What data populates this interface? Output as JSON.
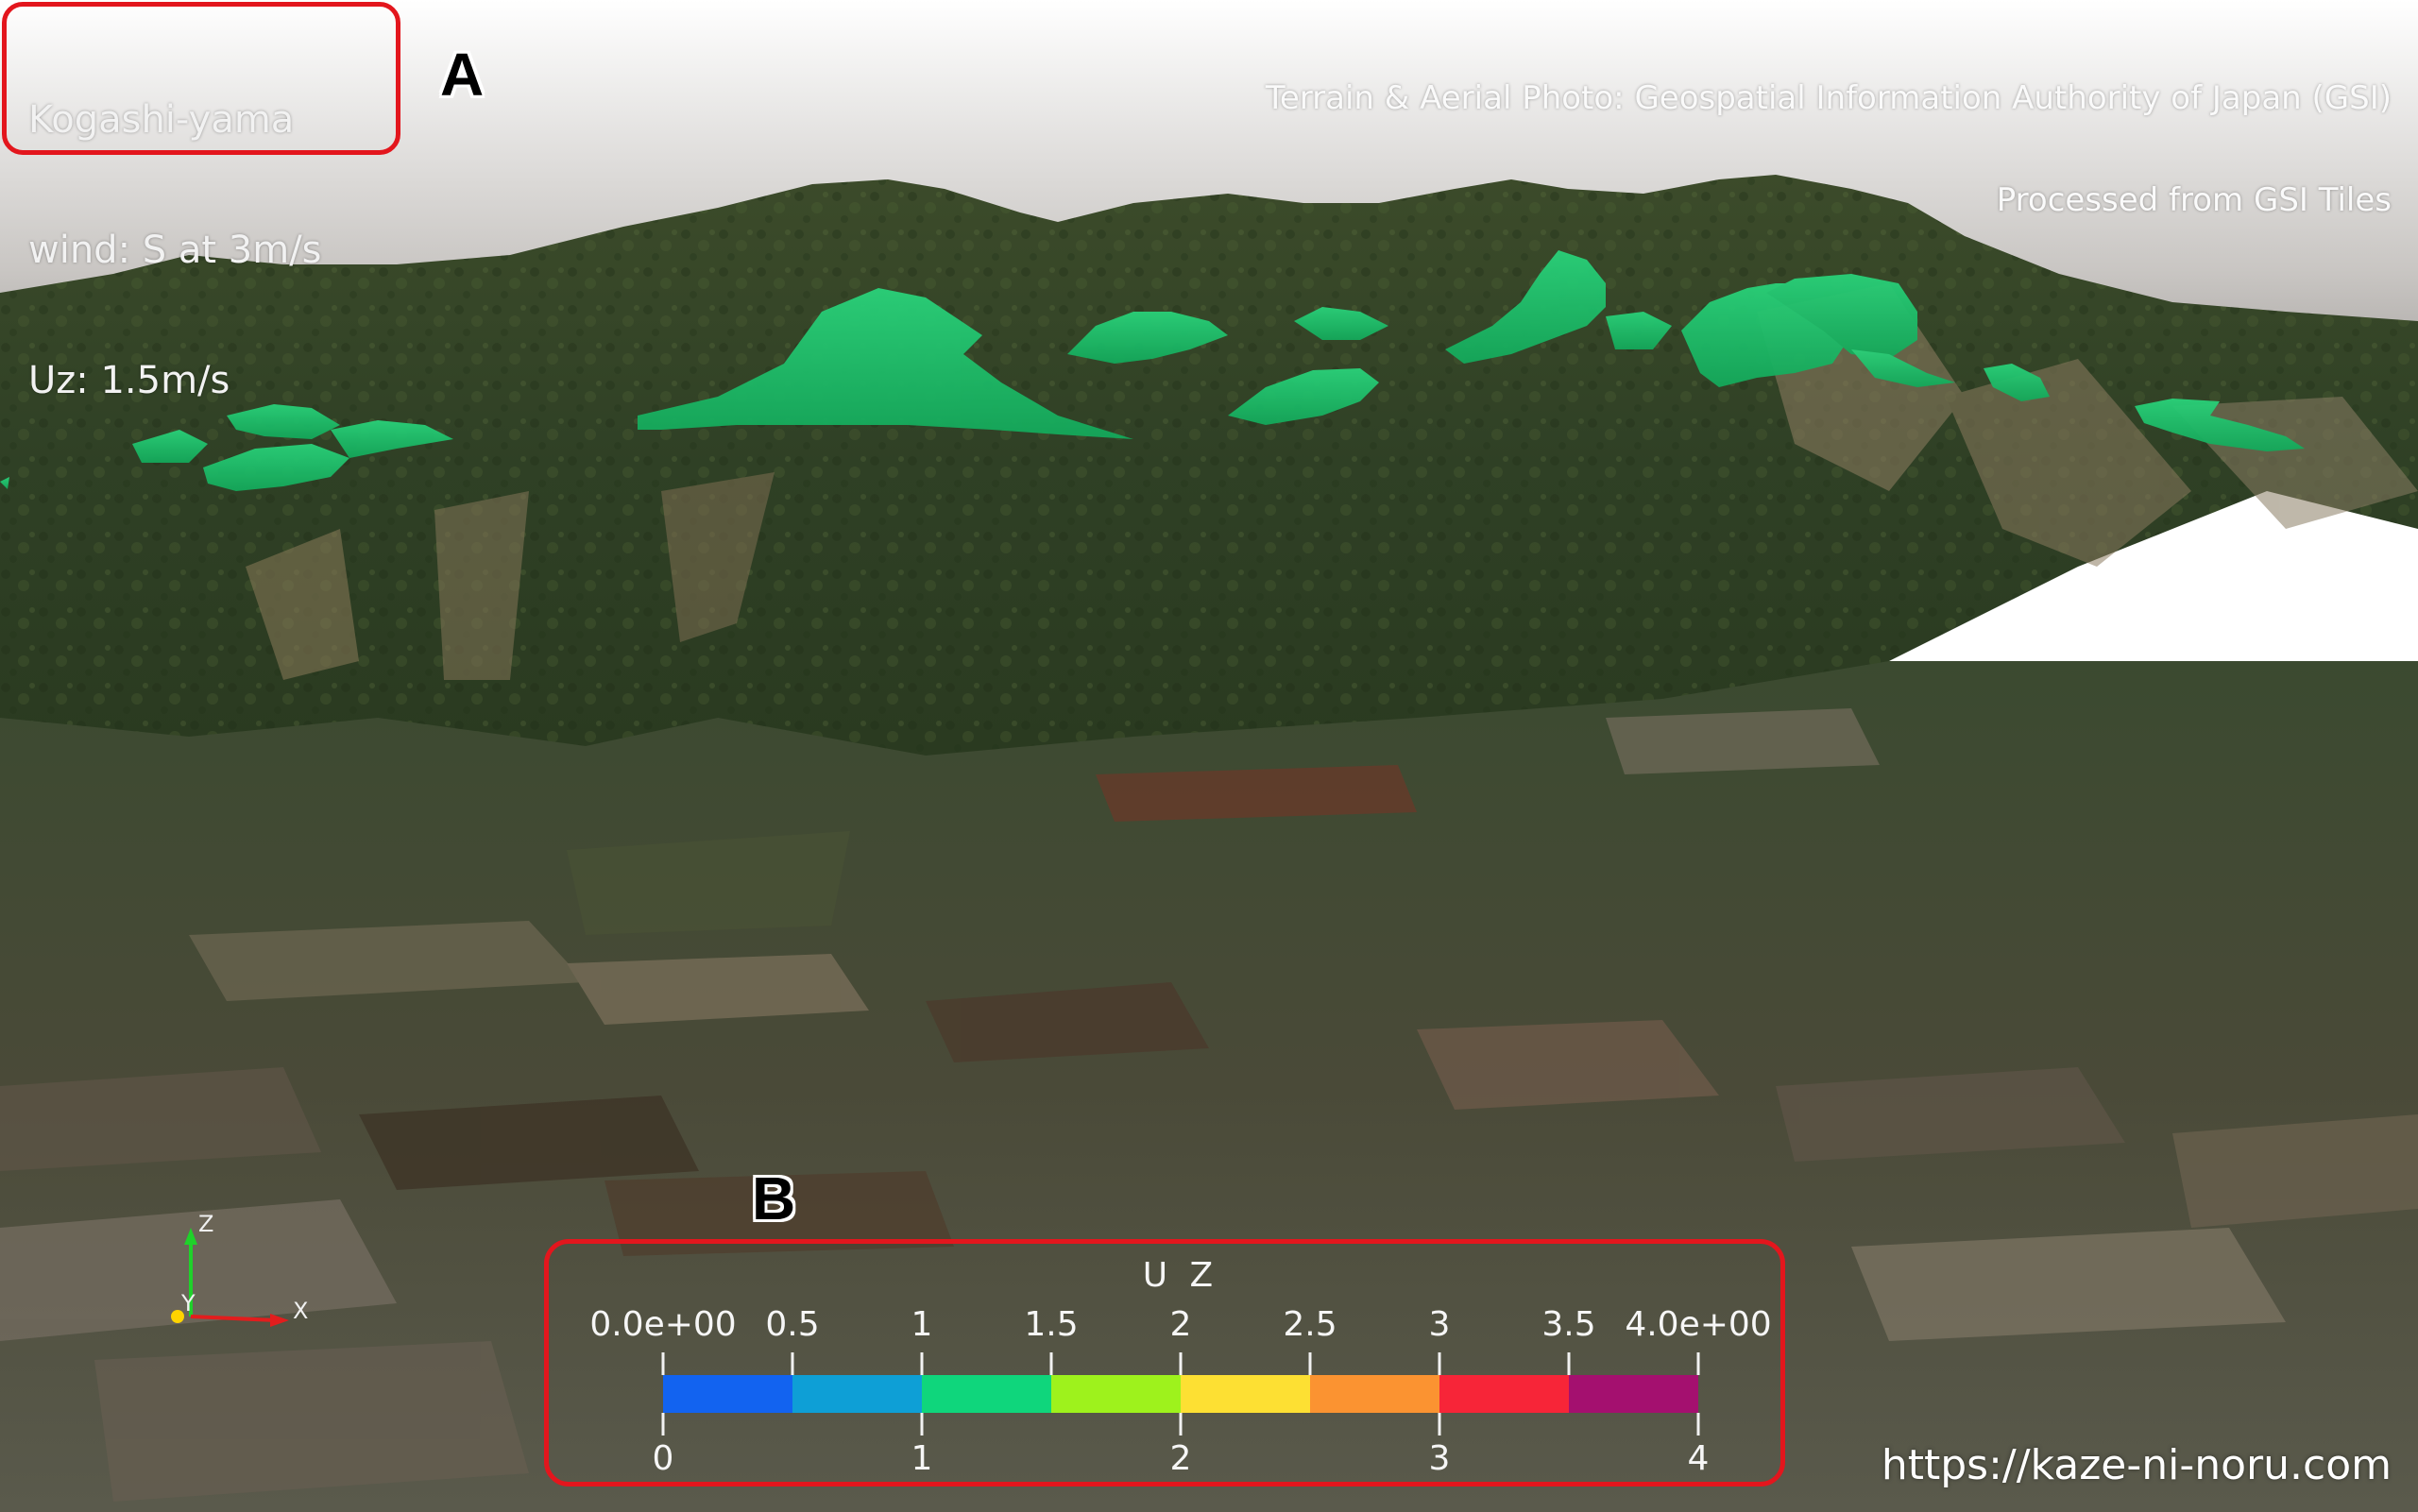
{
  "overlay": {
    "site_name": "Kogashi-yama",
    "wind": "wind: S at 3m/s",
    "uz": "Uz: 1.5m/s"
  },
  "credit": {
    "line1": "Terrain & Aerial Photo: Geospatial Information Authority of Japan (GSI)",
    "line2": "Processed from GSI Tiles"
  },
  "callouts": {
    "a": "A",
    "b": "B"
  },
  "website": "https://kaze-ni-noru.com",
  "colorbar": {
    "title": "U Z",
    "top_labels": [
      "0.0e+00",
      "0.5",
      "1",
      "1.5",
      "2",
      "2.5",
      "3",
      "3.5",
      "4.0e+00"
    ],
    "bottom_labels": [
      "0",
      "1",
      "2",
      "3",
      "4"
    ],
    "range": [
      0,
      4
    ],
    "bin_colors": [
      "#1263f0",
      "#0e9fd6",
      "#0fd67c",
      "#9ef21c",
      "#fde033",
      "#fb9331",
      "#f72538",
      "#a4106f"
    ]
  },
  "axes": {
    "x": "X",
    "y": "Y",
    "z": "Z"
  },
  "colors": {
    "sky": "#8d8b88",
    "terrain_dark": "#2d3e22",
    "terrain_mid": "#4b5a32",
    "isosurface": "#19c068",
    "highlight_box": "#e3161d"
  }
}
